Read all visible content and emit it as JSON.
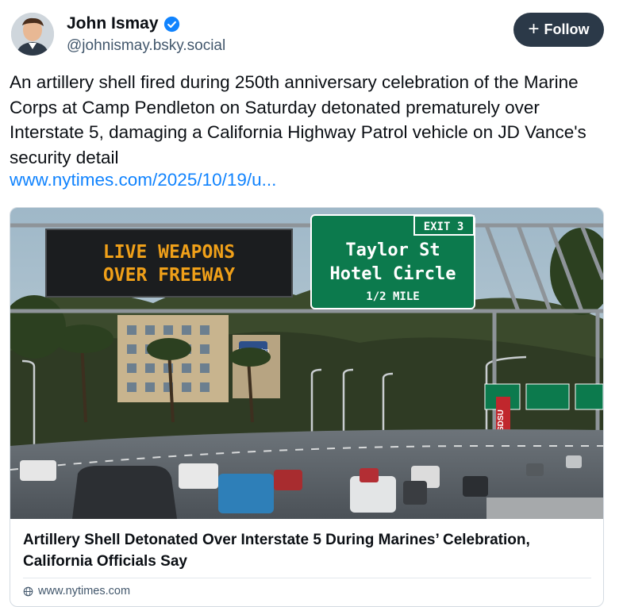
{
  "author": {
    "name": "John Ismay",
    "handle": "@johnismay.bsky.social",
    "verified": true
  },
  "follow_button": {
    "label": "Follow",
    "icon": "plus-icon"
  },
  "post": {
    "text": "An artillery shell fired during 250th anniversary celebration of the Marine Corps at Camp Pendleton on Saturday detonated prematurely over Interstate 5, damaging a California Highway Patrol vehicle on JD Vance's security detail",
    "link": "www.nytimes.com/2025/10/19/u..."
  },
  "link_card": {
    "title": "Artillery Shell Detonated Over Interstate 5 During Marines’ Celebration, California Officials Say",
    "domain": "www.nytimes.com",
    "image": {
      "message_board": [
        "LIVE WEAPONS",
        "OVER FREEWAY"
      ],
      "exit_sign": {
        "exit": "EXIT 3",
        "line1": "Taylor St",
        "line2": "Hotel Circle",
        "distance": "1/2 MILE"
      },
      "vertical_sign": "SDSU",
      "hotel_sign": "Hampton Inn"
    }
  },
  "colors": {
    "follow_bg": "#2b3948",
    "link": "#1083fe",
    "verified": "#1083fe",
    "handle": "#42576c",
    "highway_sign": "#0c7a4d",
    "led_text": "#f0a019"
  }
}
